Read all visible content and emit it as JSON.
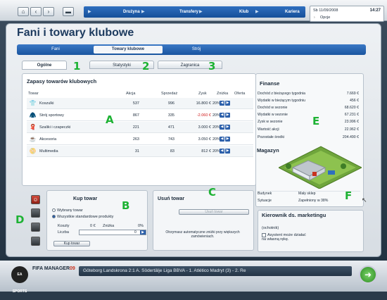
{
  "nav": {
    "home": "⌂",
    "back": "‹",
    "forward": "›",
    "menu_icon": "▬"
  },
  "menu": {
    "items": [
      "Drużyna",
      "Transfery",
      "Klub",
      "Kariera"
    ]
  },
  "datebox": {
    "date": "Sb 11/09/2008",
    "time": "14:27",
    "options": "Opcje"
  },
  "page_title": "Fani i towary klubowe",
  "tabs": [
    "Fani",
    "Towary klubowe",
    "Strój"
  ],
  "subtabs": [
    "Ogólne",
    "Statystyki",
    "Zagranica"
  ],
  "markers": {
    "one": "1",
    "two": "2",
    "three": "3",
    "a": "A",
    "b": "B",
    "c": "C",
    "d": "D",
    "e": "E",
    "f": "F"
  },
  "inventory": {
    "title": "Zapasy towarów klubowych",
    "headers": {
      "item": "Towar",
      "stock": "Akcja",
      "sold": "Sprzedaż",
      "profit": "Zysk",
      "discount": "Zniżka",
      "offer": "Oferta"
    },
    "rows": [
      {
        "name": "Koszulki",
        "stock": "537",
        "sold": "996",
        "profit": "16.800 €",
        "discount": "20%",
        "negative": false
      },
      {
        "name": "Strój sportowy",
        "stock": "867",
        "sold": "335",
        "profit": "-2.060 €",
        "discount": "20%",
        "negative": true
      },
      {
        "name": "Szaliki i czapeczki",
        "stock": "221",
        "sold": "471",
        "profit": "3.000 €",
        "discount": "20%",
        "negative": false
      },
      {
        "name": "Akcesoria",
        "stock": "263",
        "sold": "743",
        "profit": "3.050 €",
        "discount": "20%",
        "negative": false
      },
      {
        "name": "Multimedia",
        "stock": "31",
        "sold": "83",
        "profit": "812 €",
        "discount": "20%",
        "negative": false
      }
    ]
  },
  "finance": {
    "title": "Finanse",
    "rows": [
      {
        "label": "Dochód z bieżącego tygodnia",
        "value": "7.669 €"
      },
      {
        "label": "Wydatki w bieżącym tygodniu",
        "value": "456 €"
      },
      {
        "label": "Dochód w sezonie",
        "value": "68.620 €"
      },
      {
        "label": "Wydatki w sezonie",
        "value": "67.231 €"
      },
      {
        "label": "Zysk w sezonie",
        "value": "23.996 €"
      },
      {
        "label": "Wartość akcji",
        "value": "22.962 €"
      },
      {
        "label": "Pozostałe środki",
        "value": "204.490 €"
      }
    ]
  },
  "warehouse": {
    "title": "Magazyn",
    "building_label": "Budynek",
    "building_value": "Mały sklep",
    "situation_label": "Sytuacje",
    "situation_value": "Zapełniony w 38%"
  },
  "buy": {
    "title": "Kup towar",
    "option_selected": "Wybrany towar",
    "option_all": "Wszystkie standardowe produkty",
    "costs_label": "Koszty",
    "costs_value": "0 €",
    "discount_label": "Zniżka",
    "discount_value": "0%",
    "qty_label": "Liczba",
    "qty_value": "0",
    "button": "Kup towar"
  },
  "remove": {
    "title": "Usuń towar",
    "button": "Usuń towar",
    "note": "Otrzymasz automatyczne zniżki przy większych zamówieniach."
  },
  "manager": {
    "title": "Kierownik ds. marketingu",
    "subtitle": "(ochotnik)",
    "checkbox": "Asystent może działać na własną rękę."
  },
  "bottom": {
    "logo_ea": "EA SPORTS",
    "logo": "FIFA MANAGER",
    "logo_year": "09",
    "ticker": "Göteborg   Landskrona 2:1 A. Södertälje   Liga BBVA - 1. Atlético Madryt (3) - 2. Re"
  },
  "colors": {
    "accent": "#1a559f",
    "marker": "#1db233",
    "negative": "#d01818"
  }
}
